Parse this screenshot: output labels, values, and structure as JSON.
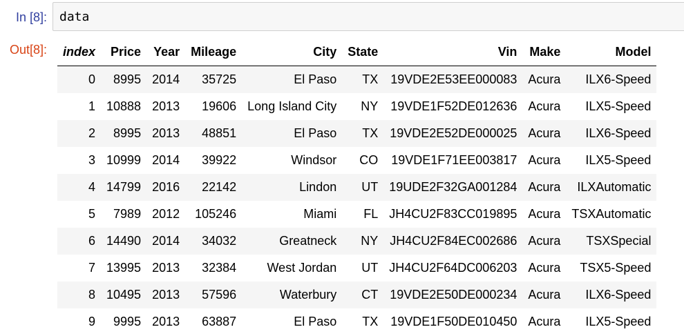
{
  "input_prompt": "In [8]:",
  "output_prompt": "Out[8]:",
  "code": "data",
  "table": {
    "columns": [
      "index",
      "Price",
      "Year",
      "Mileage",
      "City",
      "State",
      "Vin",
      "Make",
      "Model"
    ],
    "rows": [
      [
        "0",
        "8995",
        "2014",
        "35725",
        "El Paso",
        "TX",
        "19VDE2E53EE000083",
        "Acura",
        "ILX6-Speed"
      ],
      [
        "1",
        "10888",
        "2013",
        "19606",
        "Long Island City",
        "NY",
        "19VDE1F52DE012636",
        "Acura",
        "ILX5-Speed"
      ],
      [
        "2",
        "8995",
        "2013",
        "48851",
        "El Paso",
        "TX",
        "19VDE2E52DE000025",
        "Acura",
        "ILX6-Speed"
      ],
      [
        "3",
        "10999",
        "2014",
        "39922",
        "Windsor",
        "CO",
        "19VDE1F71EE003817",
        "Acura",
        "ILX5-Speed"
      ],
      [
        "4",
        "14799",
        "2016",
        "22142",
        "Lindon",
        "UT",
        "19UDE2F32GA001284",
        "Acura",
        "ILXAutomatic"
      ],
      [
        "5",
        "7989",
        "2012",
        "105246",
        "Miami",
        "FL",
        "JH4CU2F83CC019895",
        "Acura",
        "TSXAutomatic"
      ],
      [
        "6",
        "14490",
        "2014",
        "34032",
        "Greatneck",
        "NY",
        "JH4CU2F84EC002686",
        "Acura",
        "TSXSpecial"
      ],
      [
        "7",
        "13995",
        "2013",
        "32384",
        "West Jordan",
        "UT",
        "JH4CU2F64DC006203",
        "Acura",
        "TSX5-Speed"
      ],
      [
        "8",
        "10495",
        "2013",
        "57596",
        "Waterbury",
        "CT",
        "19VDE2E50DE000234",
        "Acura",
        "ILX6-Speed"
      ],
      [
        "9",
        "9995",
        "2013",
        "63887",
        "El Paso",
        "TX",
        "19VDE1F50DE010450",
        "Acura",
        "ILX5-Speed"
      ]
    ]
  },
  "colors": {
    "input_prompt": "#303f9f",
    "output_prompt": "#d84315",
    "input_background": "#f7f7f7",
    "input_border": "#cfcfcf",
    "row_stripe": "#f5f5f5"
  }
}
